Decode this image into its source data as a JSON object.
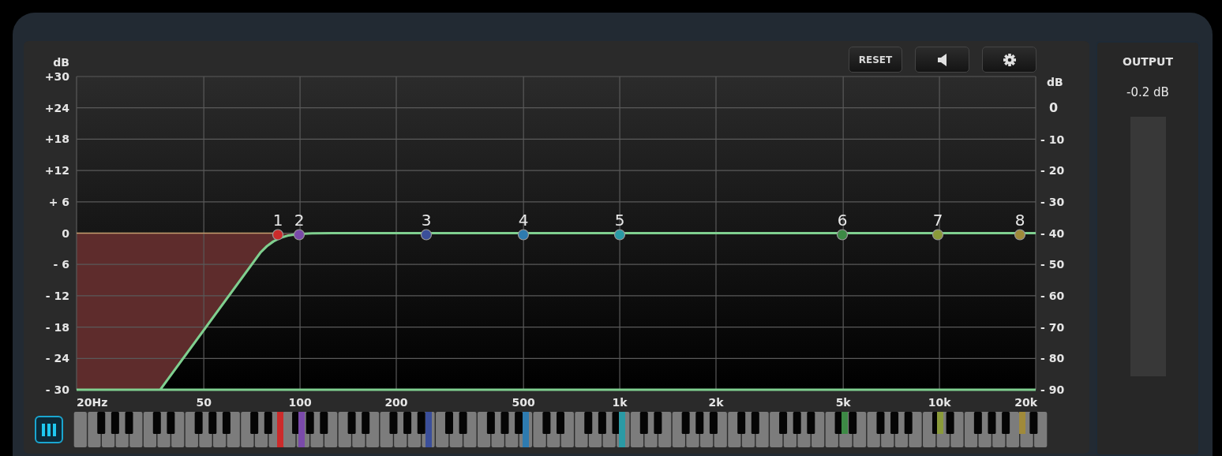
{
  "toolbar": [
    {
      "kind": "text",
      "label": "RESET"
    },
    {
      "kind": "speaker"
    },
    {
      "kind": "gear"
    }
  ],
  "left_axis": {
    "unit": "dB",
    "ticks": [
      "+30",
      "+24",
      "+18",
      "+12",
      "+ 6",
      "0",
      "-  6",
      "- 12",
      "- 18",
      "- 24",
      "- 30"
    ]
  },
  "right_axis": {
    "unit": "dB",
    "ticks": [
      "0",
      "- 10",
      "- 20",
      "- 30",
      "- 40",
      "- 50",
      "- 60",
      "- 70",
      "- 80",
      "- 90"
    ]
  },
  "freq_axis": {
    "ticks": [
      "20Hz",
      "50",
      "100",
      "200",
      "500",
      "1k",
      "2k",
      "5k",
      "10k",
      "20k"
    ]
  },
  "bands": [
    {
      "label": "1",
      "color": "#cc2b2b"
    },
    {
      "label": "2",
      "color": "#7a4aaa"
    },
    {
      "label": "3",
      "color": "#3b4f9a"
    },
    {
      "label": "4",
      "color": "#2e7bb0"
    },
    {
      "label": "5",
      "color": "#2a9aa5"
    },
    {
      "label": "6",
      "color": "#3d8a45"
    },
    {
      "label": "7",
      "color": "#8a9a3a"
    },
    {
      "label": "8",
      "color": "#a08a3a"
    }
  ],
  "keyboard_toggle": {
    "on": true
  },
  "output": {
    "title": "OUTPUT",
    "reading": "-0.2 dB"
  }
}
